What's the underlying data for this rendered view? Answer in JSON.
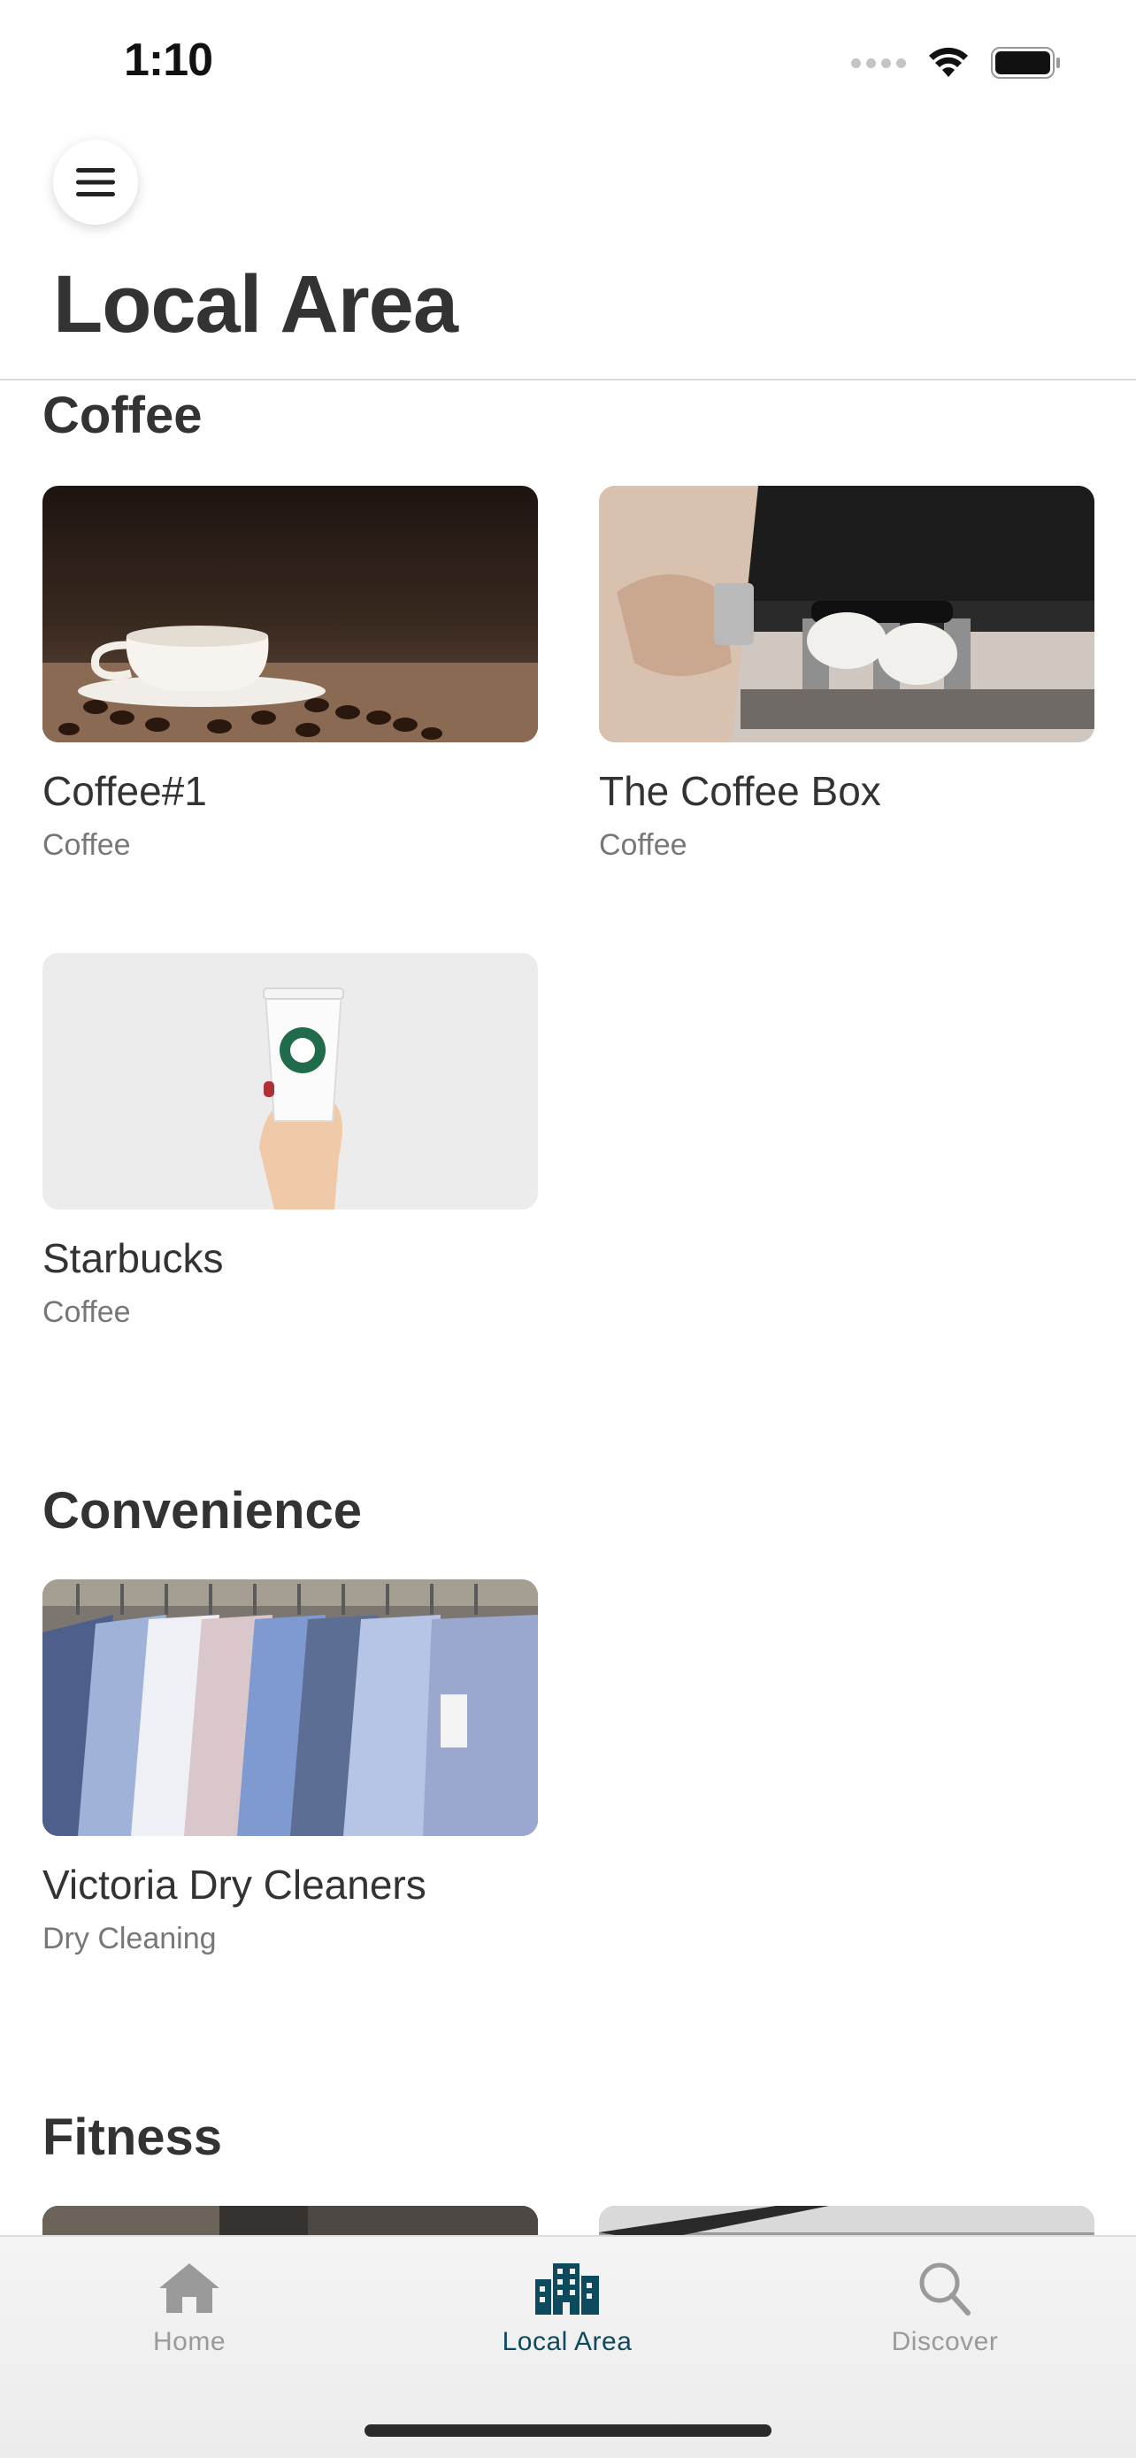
{
  "status": {
    "time": "1:10"
  },
  "header": {
    "title": "Local Area"
  },
  "sections": [
    {
      "title": "Coffee",
      "items": [
        {
          "name": "Coffee#1",
          "category": "Coffee"
        },
        {
          "name": "The Coffee Box",
          "category": "Coffee"
        },
        {
          "name": "Starbucks",
          "category": "Coffee"
        }
      ]
    },
    {
      "title": "Convenience",
      "items": [
        {
          "name": "Victoria Dry Cleaners",
          "category": "Dry Cleaning"
        }
      ]
    },
    {
      "title": "Fitness",
      "items": []
    }
  ],
  "tabs": [
    {
      "label": "Home",
      "icon": "home-icon",
      "active": false
    },
    {
      "label": "Local Area",
      "icon": "city-icon",
      "active": true
    },
    {
      "label": "Discover",
      "icon": "search-icon",
      "active": false
    }
  ],
  "colors": {
    "accent": "#0e4a5e",
    "inactive": "#9a9a9a",
    "text": "#333333"
  }
}
